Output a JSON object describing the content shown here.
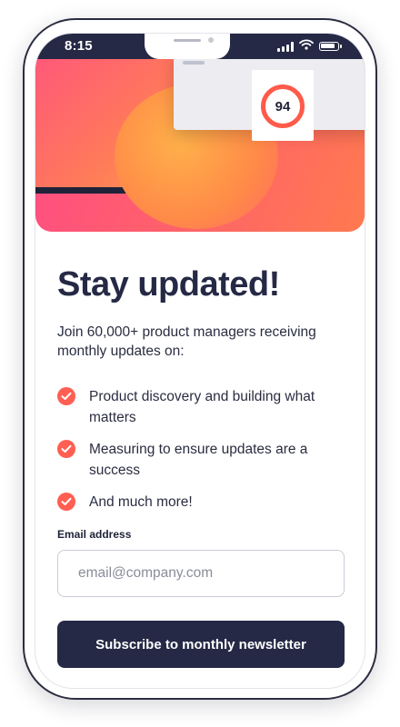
{
  "status_bar": {
    "time": "8:15"
  },
  "hero": {
    "score": "94"
  },
  "main": {
    "headline": "Stay updated!",
    "intro": "Join 60,000+ product managers receiving monthly updates on:",
    "benefits": [
      {
        "text": "Product discovery and building what matters"
      },
      {
        "text": "Measuring to ensure updates are a success"
      },
      {
        "text": "And much more!"
      }
    ]
  },
  "form": {
    "email_label": "Email address",
    "email_placeholder": "email@company.com",
    "email_value": "",
    "subscribe_label": "Subscribe to monthly newsletter"
  },
  "colors": {
    "primary": "#252945",
    "accent": "#ff5f52",
    "hero_start": "#ff4a86",
    "hero_end": "#ff7a4f"
  },
  "icons": [
    "signal-icon",
    "wifi-icon",
    "battery-icon",
    "check-icon"
  ]
}
